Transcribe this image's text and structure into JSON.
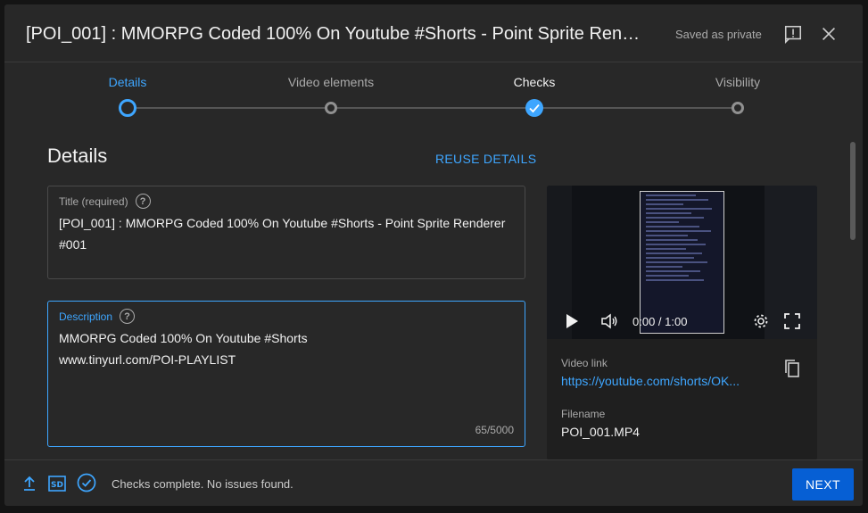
{
  "header": {
    "title": "[POI_001] : MMORPG Coded 100% On Youtube #Shorts - Point Sprite Rend...",
    "saved_status": "Saved as private",
    "feedback_icon": "feedback-icon",
    "close_icon": "close-icon"
  },
  "stepper": {
    "steps": [
      {
        "label": "Details",
        "state": "active"
      },
      {
        "label": "Video elements",
        "state": "pending"
      },
      {
        "label": "Checks",
        "state": "done"
      },
      {
        "label": "Visibility",
        "state": "pending"
      }
    ]
  },
  "details": {
    "section_title": "Details",
    "reuse_label": "REUSE DETAILS",
    "title_field": {
      "label": "Title (required)",
      "value": "[POI_001] : MMORPG Coded 100% On Youtube #Shorts - Point Sprite Renderer #001"
    },
    "description_field": {
      "label": "Description",
      "value": "MMORPG Coded 100% On Youtube #Shorts\nwww.tinyurl.com/POI-PLAYLIST",
      "counter": "65/5000"
    }
  },
  "video": {
    "time": "0:00 / 1:00",
    "link_label": "Video link",
    "link_value": "https://youtube.com/shorts/OK...",
    "filename_label": "Filename",
    "filename_value": "POI_001.MP4"
  },
  "footer": {
    "status": "Checks complete. No issues found.",
    "next_label": "NEXT"
  },
  "colors": {
    "accent": "#3ea6ff",
    "primary_button": "#065fd4",
    "dialog_bg": "#282828"
  }
}
